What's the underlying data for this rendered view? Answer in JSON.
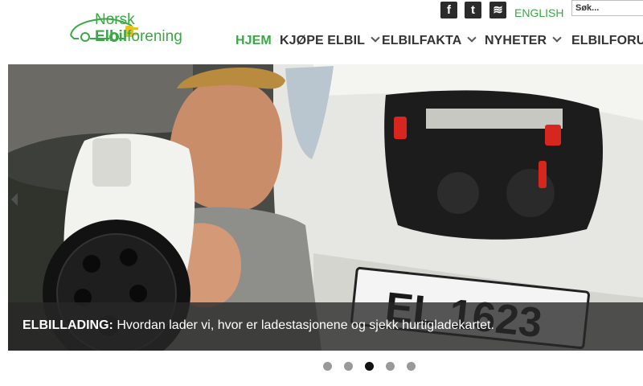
{
  "logo": {
    "line1": "Norsk",
    "line2_bold": "Elbil",
    "line2_rest": "forening"
  },
  "topbar": {
    "social": [
      {
        "icon": "facebook-icon",
        "glyph": "f"
      },
      {
        "icon": "twitter-icon",
        "glyph": "t"
      },
      {
        "icon": "rss-icon",
        "glyph": "≋"
      }
    ],
    "language_link": "ENGLISH",
    "search_placeholder": "Søk..."
  },
  "nav": {
    "items": [
      {
        "label": "HJEM",
        "active": true,
        "has_dropdown": false
      },
      {
        "label": "KJØPE ELBIL",
        "active": false,
        "has_dropdown": true
      },
      {
        "label": "ELBILFAKTA",
        "active": false,
        "has_dropdown": true
      },
      {
        "label": "NYHETER",
        "active": false,
        "has_dropdown": true
      },
      {
        "label": "ELBILFORUM",
        "active": false,
        "has_dropdown": false
      }
    ]
  },
  "slider": {
    "caption_bold": "ELBILLADING:",
    "caption_text": " Hvordan lader vi, hvor er ladestasjonene og sjekk hurtigladekartet.",
    "plate_text": "EL 1623",
    "dots": [
      {
        "active": false
      },
      {
        "active": false
      },
      {
        "active": true
      },
      {
        "active": false
      },
      {
        "active": false
      }
    ]
  },
  "colors": {
    "brand_green": "#3aa845",
    "nav_text": "#333333",
    "dot_active": "#111111",
    "dot_inactive": "#999999"
  }
}
